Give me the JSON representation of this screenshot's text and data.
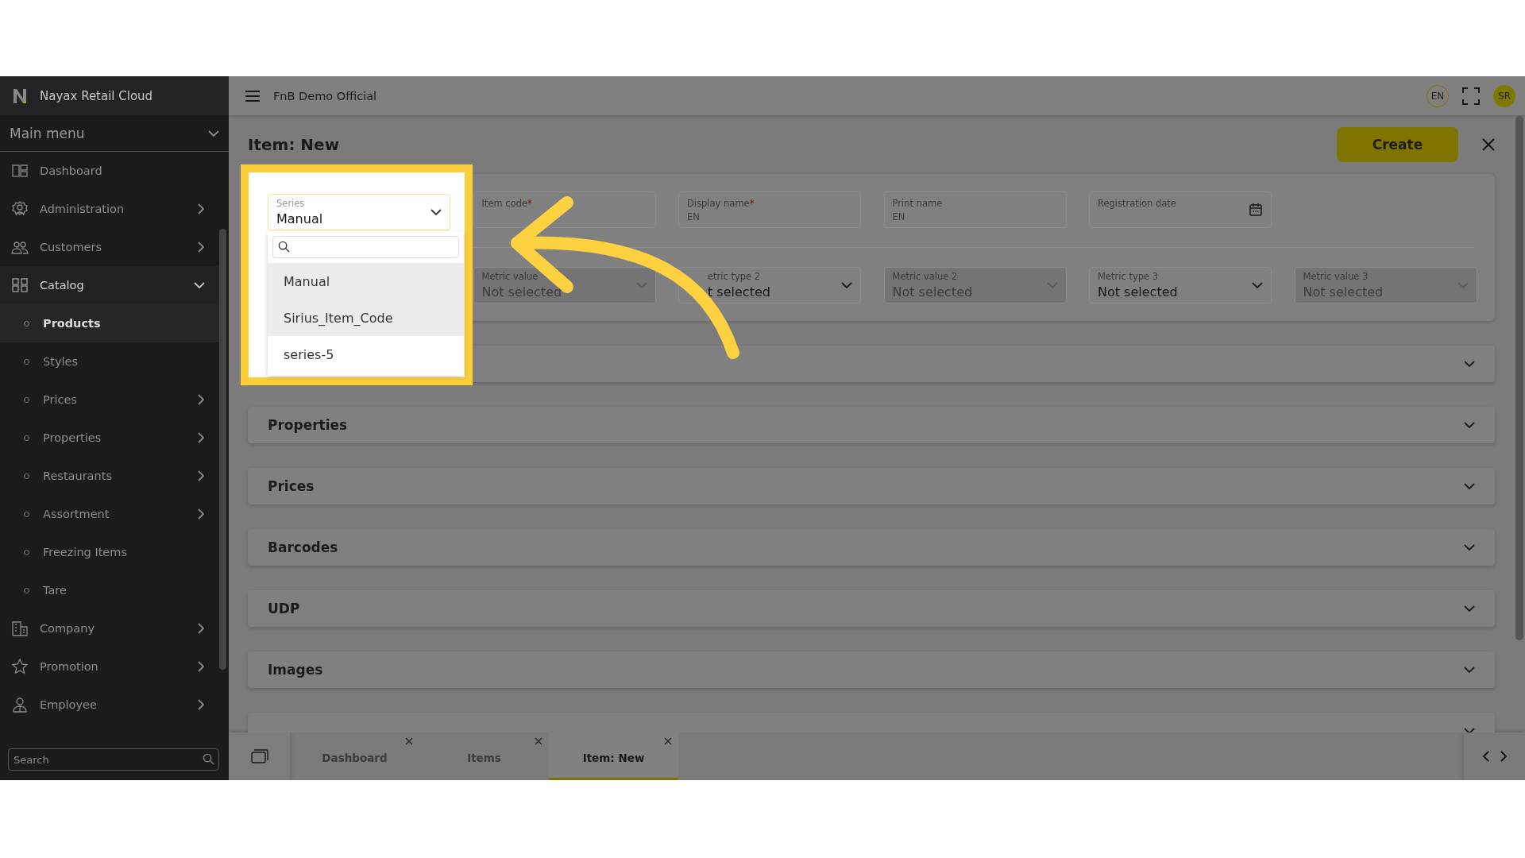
{
  "sidebar": {
    "brand": "Nayax Retail Cloud",
    "menu_title": "Main menu",
    "search": {
      "placeholder": "Search"
    },
    "items": [
      {
        "label": "Dashboard",
        "has_submenu": false,
        "expanded": false
      },
      {
        "label": "Administration",
        "has_submenu": true,
        "expanded": false
      },
      {
        "label": "Customers",
        "has_submenu": true,
        "expanded": false
      },
      {
        "label": "Catalog",
        "has_submenu": true,
        "expanded": true,
        "children": [
          {
            "label": "Products",
            "has_submenu": false,
            "selected": true
          },
          {
            "label": "Styles",
            "has_submenu": false,
            "selected": false
          },
          {
            "label": "Prices",
            "has_submenu": true,
            "selected": false
          },
          {
            "label": "Properties",
            "has_submenu": true,
            "selected": false
          },
          {
            "label": "Restaurants",
            "has_submenu": true,
            "selected": false
          },
          {
            "label": "Assortment",
            "has_submenu": true,
            "selected": false
          },
          {
            "label": "Freezing Items",
            "has_submenu": false,
            "selected": false
          },
          {
            "label": "Tare",
            "has_submenu": false,
            "selected": false
          }
        ]
      },
      {
        "label": "Company",
        "has_submenu": true,
        "expanded": false
      },
      {
        "label": "Promotion",
        "has_submenu": true,
        "expanded": false
      },
      {
        "label": "Employee",
        "has_submenu": true,
        "expanded": false
      }
    ]
  },
  "top_bar": {
    "company": "FnB Demo Official",
    "language": "EN",
    "user_initials": "SR"
  },
  "page": {
    "title": "Item: New",
    "create_button": "Create"
  },
  "series_field": {
    "label": "Series",
    "value": "Manual",
    "options": [
      {
        "label": "Manual",
        "highlighted": true
      },
      {
        "label": "Sirius_Item_Code",
        "highlighted": true
      },
      {
        "label": "series-5",
        "highlighted": false
      }
    ]
  },
  "fields_row_1": [
    {
      "kind": "text",
      "label": "Item code",
      "required_mark": "*"
    },
    {
      "kind": "text",
      "label": "Display name",
      "required_mark": "*",
      "placeholder": "EN"
    },
    {
      "kind": "text",
      "label": "Print name",
      "placeholder": "EN"
    },
    {
      "kind": "date",
      "label": "Registration date"
    }
  ],
  "fields_row_2": [
    {
      "label": "Metric value",
      "value": "Not selected",
      "disabled": true
    },
    {
      "label": "etric type 2",
      "value": "t selected",
      "disabled": false,
      "partly_hidden": true
    },
    {
      "label": "Metric value 2",
      "value": "Not selected",
      "disabled": true
    },
    {
      "label": "Metric type 3",
      "value": "Not selected",
      "disabled": false
    },
    {
      "label": "Metric value 3",
      "value": "Not selected",
      "disabled": true
    }
  ],
  "sections": [
    {
      "kind": "covered"
    },
    {
      "kind": "section",
      "title": "Properties"
    },
    {
      "kind": "section",
      "title": "Prices"
    },
    {
      "kind": "section",
      "title": "Barcodes"
    },
    {
      "kind": "section",
      "title": "UDP"
    },
    {
      "kind": "section",
      "title": "Images"
    },
    {
      "kind": "covered"
    }
  ],
  "bottom_tabs": [
    {
      "label": "Dashboard",
      "selected": false
    },
    {
      "label": "Items",
      "selected": false
    },
    {
      "label": "Item: New",
      "selected": true
    }
  ]
}
